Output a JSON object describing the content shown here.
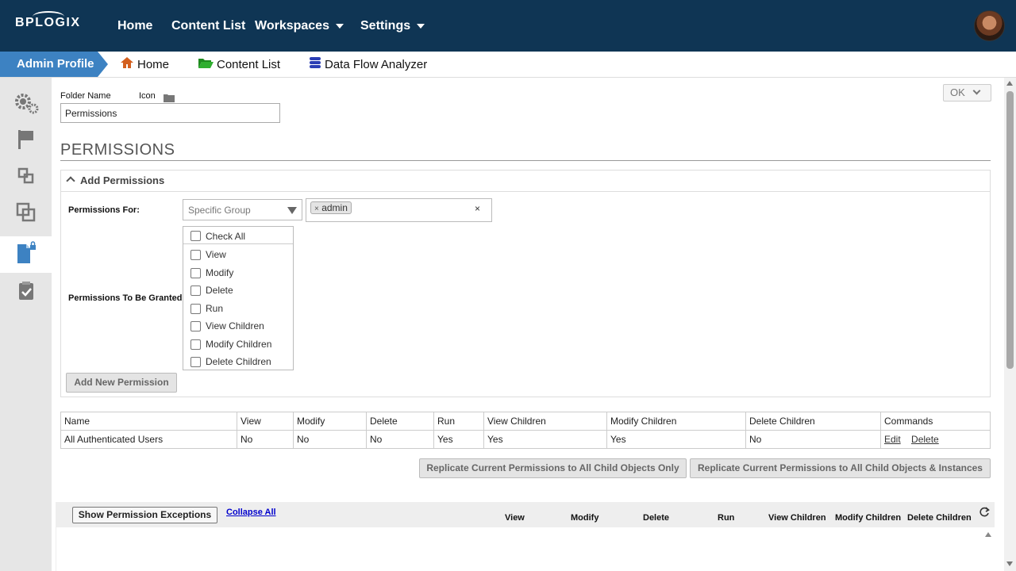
{
  "topbar": {
    "logo": "BPLOGIX",
    "nav": [
      "Home",
      "Content List",
      "Workspaces",
      "Settings"
    ]
  },
  "subbar": {
    "profile": "Admin Profile",
    "links": [
      "Home",
      "Content List",
      "Data Flow Analyzer"
    ]
  },
  "form": {
    "folder_name_label": "Folder Name",
    "icon_label": "Icon",
    "folder_name_value": "Permissions",
    "ok_label": "OK"
  },
  "permissions": {
    "title": "PERMISSIONS",
    "add_header": "Add Permissions",
    "for_label": "Permissions For:",
    "for_select": "Specific Group",
    "tag": "admin",
    "tag_remove": "×",
    "granted_label": "Permissions To Be Granted",
    "checks": [
      "Check All",
      "View",
      "Modify",
      "Delete",
      "Run",
      "View Children",
      "Modify Children",
      "Delete Children"
    ],
    "add_button": "Add New Permission"
  },
  "table": {
    "headers": [
      "Name",
      "View",
      "Modify",
      "Delete",
      "Run",
      "View Children",
      "Modify Children",
      "Delete Children",
      "Commands"
    ],
    "rows": [
      {
        "name": "All Authenticated Users",
        "view": "No",
        "modify": "No",
        "delete": "No",
        "run": "Yes",
        "view_children": "Yes",
        "modify_children": "Yes",
        "delete_children": "No",
        "edit": "Edit",
        "del": "Delete"
      }
    ]
  },
  "replicate": {
    "child_only": "Replicate Current Permissions to All Child Objects Only",
    "child_instances": "Replicate Current Permissions to All Child Objects & Instances"
  },
  "exceptions": {
    "show_button": "Show Permission Exceptions",
    "collapse": "Collapse All",
    "columns": [
      "View",
      "Modify",
      "Delete",
      "Run",
      "View Children",
      "Modify Children",
      "Delete Children"
    ]
  },
  "colors": {
    "topbar": "#0f3554",
    "accent": "#3d82c2"
  }
}
